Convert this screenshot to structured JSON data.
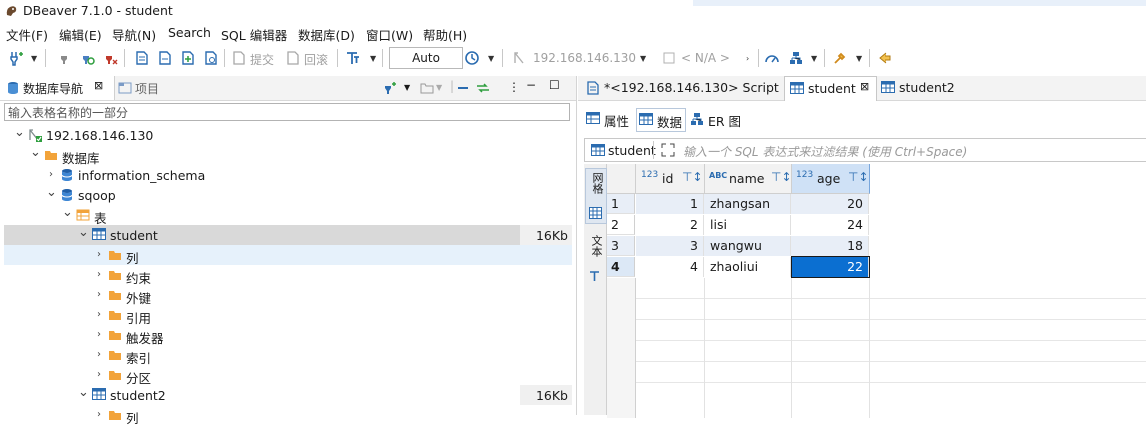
{
  "window": {
    "title": "DBeaver 7.1.0 - student"
  },
  "menu": [
    "文件(F)",
    "编辑(E)",
    "导航(N)",
    "Search",
    "SQL 编辑器",
    "数据库(D)",
    "窗口(W)",
    "帮助(H)"
  ],
  "toolbar": {
    "commit_label": "提交",
    "rollback_label": "回滚",
    "mode_value": "Auto",
    "connection_label": "192.168.146.130",
    "schema_label": "< N/A >"
  },
  "left": {
    "tab_navigator": "数据库导航",
    "tab_projects": "项目",
    "filter_placeholder": "输入表格名称的一部分",
    "tree": [
      {
        "label": "192.168.146.130",
        "level": 0,
        "expanded": true,
        "icon": "server-icon"
      },
      {
        "label": "数据库",
        "level": 1,
        "expanded": true,
        "icon": "folder-icon"
      },
      {
        "label": "information_schema",
        "level": 2,
        "expanded": false,
        "icon": "database-icon"
      },
      {
        "label": "sqoop",
        "level": 2,
        "expanded": true,
        "icon": "database-icon"
      },
      {
        "label": "表",
        "level": 3,
        "expanded": true,
        "icon": "tables-folder-icon"
      },
      {
        "label": "student",
        "level": 4,
        "expanded": true,
        "icon": "table-icon",
        "size": "16Kb",
        "selected": true
      },
      {
        "label": "列",
        "level": 5,
        "expanded": false,
        "icon": "folder-icon",
        "hover": true
      },
      {
        "label": "约束",
        "level": 5,
        "expanded": false,
        "icon": "folder-icon"
      },
      {
        "label": "外键",
        "level": 5,
        "expanded": false,
        "icon": "folder-icon"
      },
      {
        "label": "引用",
        "level": 5,
        "expanded": false,
        "icon": "folder-icon"
      },
      {
        "label": "触发器",
        "level": 5,
        "expanded": false,
        "icon": "folder-icon"
      },
      {
        "label": "索引",
        "level": 5,
        "expanded": false,
        "icon": "folder-icon"
      },
      {
        "label": "分区",
        "level": 5,
        "expanded": false,
        "icon": "folder-icon"
      },
      {
        "label": "student2",
        "level": 4,
        "expanded": true,
        "icon": "table-icon",
        "size": "16Kb"
      },
      {
        "label": "列",
        "level": 5,
        "expanded": false,
        "icon": "folder-icon"
      }
    ]
  },
  "right": {
    "editor_tabs": [
      {
        "label": "*<192.168.146.130> Script",
        "active": false
      },
      {
        "label": "student",
        "active": true
      },
      {
        "label": "student2",
        "active": false
      }
    ],
    "sub_tabs": [
      "属性",
      "数据",
      "ER 图"
    ],
    "filter_table": "student",
    "filter_placeholder": "输入一个 SQL 表达式来过滤结果 (使用 Ctrl+Space)",
    "side_tabs": [
      "网格",
      "文本"
    ],
    "columns": [
      {
        "type": "123",
        "name": "id"
      },
      {
        "type": "ABC",
        "name": "name"
      },
      {
        "type": "123",
        "name": "age"
      }
    ],
    "rows": [
      {
        "num": "1",
        "id": "1",
        "name": "zhangsan",
        "age": "20"
      },
      {
        "num": "2",
        "id": "2",
        "name": "lisi",
        "age": "24"
      },
      {
        "num": "3",
        "id": "3",
        "name": "wangwu",
        "age": "18"
      },
      {
        "num": "4",
        "id": "4",
        "name": "zhaoliui",
        "age": "22"
      }
    ]
  },
  "colors": {
    "accent": "#0b6fd1",
    "selection": "#0b6fd1",
    "row_alt": "#e8eef7",
    "folder": "#f2a33a"
  }
}
